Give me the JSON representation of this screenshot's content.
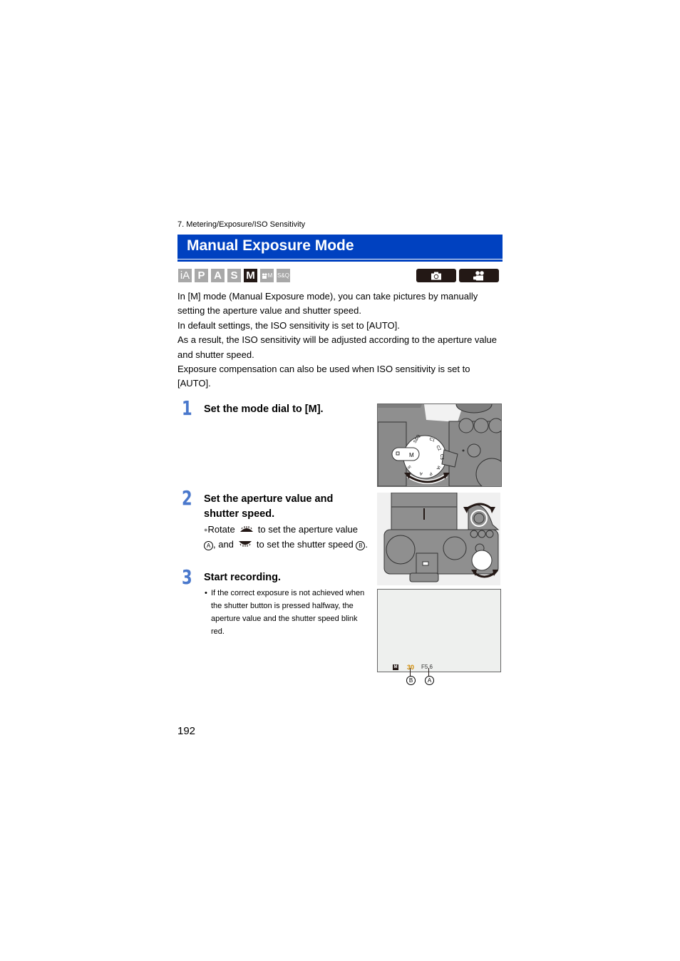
{
  "breadcrumb": "7. Metering/Exposure/ISO Sensitivity",
  "title": "Manual Exposure Mode",
  "colors": {
    "title_bar": "#0041c0",
    "step_number": "#4a78cc",
    "mode_inactive": "#a8a8a8",
    "mode_active": "#231815",
    "shutter_value": "#d08a00"
  },
  "mode_icons": [
    {
      "label": "iA",
      "active": false
    },
    {
      "label": "P",
      "active": false
    },
    {
      "label": "A",
      "active": false
    },
    {
      "label": "S",
      "active": false
    },
    {
      "label": "M",
      "active": true
    },
    {
      "label": "M",
      "icon": "movie-camera-icon",
      "active": false
    },
    {
      "label": "S&Q",
      "active": false
    }
  ],
  "record_icons": [
    {
      "icon": "photo-camera-icon"
    },
    {
      "icon": "video-camera-icon"
    }
  ],
  "intro": [
    "In [M] mode (Manual Exposure mode), you can take pictures by manually setting the aperture value and shutter speed.",
    "In default settings, the ISO sensitivity is set to [AUTO].",
    "As a result, the ISO sensitivity will be adjusted according to the aperture value and shutter speed.",
    "Exposure compensation can also be used when ISO sensitivity is set to [AUTO]."
  ],
  "steps": [
    {
      "number": "1",
      "title": "Set the mode dial to [M]."
    },
    {
      "number": "2",
      "title": "Set the aperture value and shutter speed.",
      "bullet": {
        "rotate": "Rotate",
        "to_set_aperture": "to set the aperture value",
        "marker_a": "A",
        "and": ", and",
        "to_set_shutter": "to set the shutter speed",
        "marker_b": "B",
        "end": "."
      }
    },
    {
      "number": "3",
      "title": "Start recording.",
      "note": "If the correct exposure is not achieved when the shutter button is pressed halfway, the aperture value and the shutter speed blink red."
    }
  ],
  "figures": {
    "mode_dial": {
      "dial_labels": [
        "M",
        "S",
        "A",
        "P",
        "iA",
        "C3",
        "C2",
        "C1",
        "S&Q"
      ],
      "selected": "M"
    },
    "screen": {
      "mode": "M",
      "shutter_speed": "30",
      "aperture": "F5.6",
      "callout_b": "B",
      "callout_a": "A"
    }
  },
  "page_number": "192"
}
